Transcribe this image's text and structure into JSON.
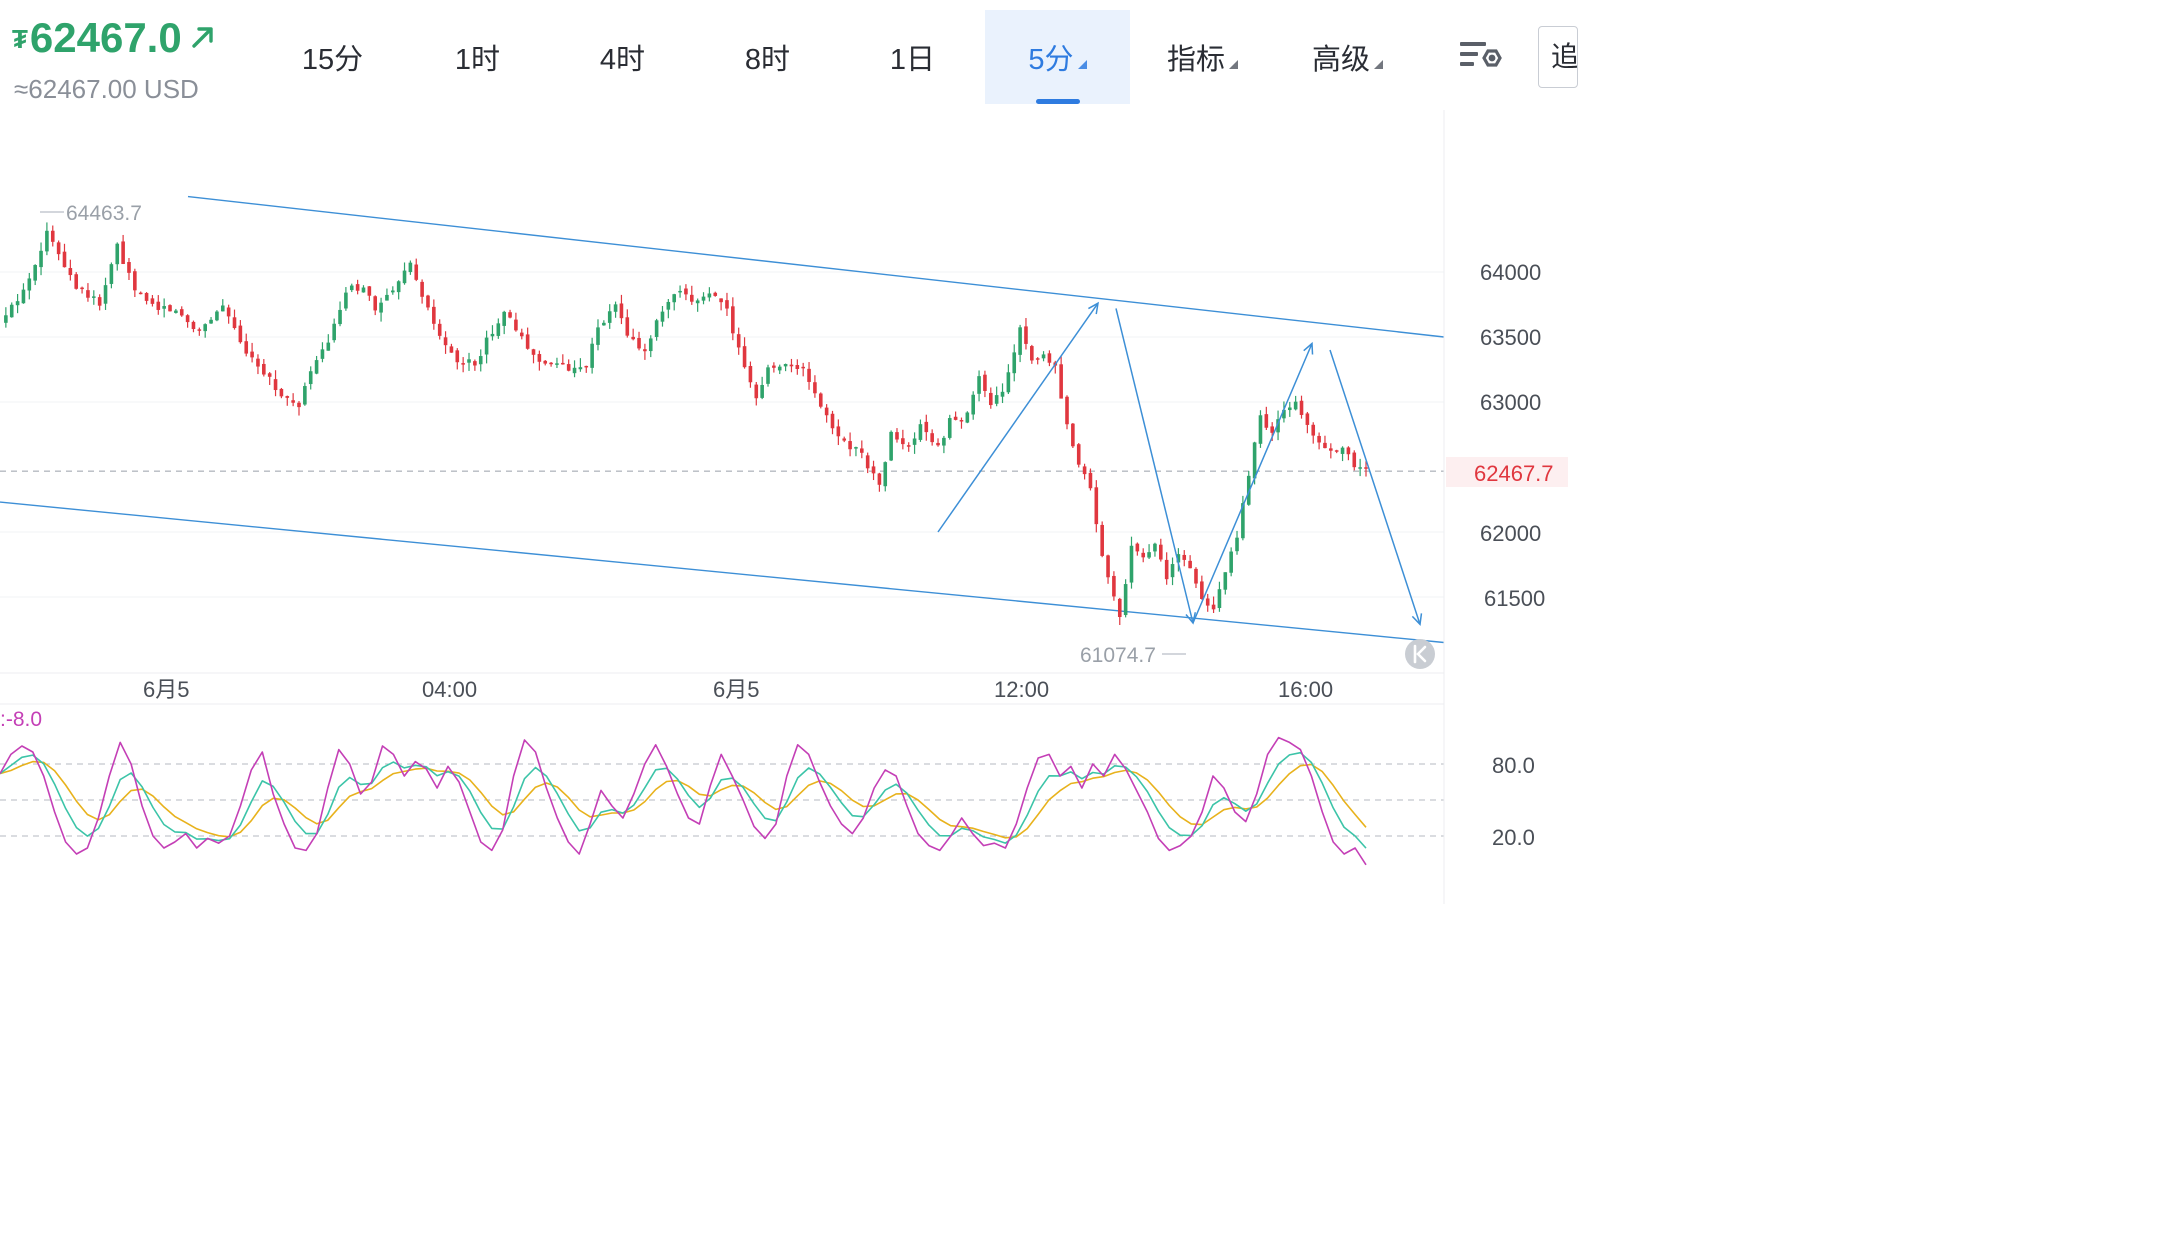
{
  "header": {
    "currency_symbol": "₮",
    "price": "62467.0",
    "usd_equiv": "≈62467.00 USD"
  },
  "tabs": [
    {
      "label": "15分",
      "dropdown": false,
      "active": false
    },
    {
      "label": "1时",
      "dropdown": false,
      "active": false
    },
    {
      "label": "4时",
      "dropdown": false,
      "active": false
    },
    {
      "label": "8时",
      "dropdown": false,
      "active": false
    },
    {
      "label": "1日",
      "dropdown": false,
      "active": false
    },
    {
      "label": "5分",
      "dropdown": true,
      "active": true
    },
    {
      "label": "指标",
      "dropdown": true,
      "active": false
    },
    {
      "label": "高级",
      "dropdown": true,
      "active": false
    }
  ],
  "edge_button_label": "追",
  "icons": {
    "price_arrow": "arrow-up-right-icon",
    "settings": "chart-settings-icon",
    "back": "back-to-latest-icon"
  },
  "colors": {
    "up": "#2fa36b",
    "down": "#e0373f",
    "trend": "#3d8fd6",
    "k_line": "#c43fb6",
    "d_line": "#3cc4a8",
    "j_line": "#e8b21c"
  },
  "chart_data": [
    {
      "type": "candlestick",
      "y_ticks": [
        "64000",
        "63500",
        "63000",
        "62000",
        "61500"
      ],
      "ylim": [
        61000,
        64800
      ],
      "x_ticks": [
        "6月5",
        "04:00",
        "6月5",
        "12:00",
        "16:00"
      ],
      "high_label": "64463.7",
      "low_label": "61074.7",
      "last_price_label": "62467.7",
      "last_price": 62467.7,
      "price_path": [
        [
          0,
          63600
        ],
        [
          4,
          63850
        ],
        [
          8,
          64300
        ],
        [
          10,
          64150
        ],
        [
          13,
          63900
        ],
        [
          17,
          63750
        ],
        [
          20,
          64200
        ],
        [
          23,
          63850
        ],
        [
          26,
          63750
        ],
        [
          30,
          63700
        ],
        [
          34,
          63550
        ],
        [
          38,
          63750
        ],
        [
          41,
          63450
        ],
        [
          44,
          63300
        ],
        [
          48,
          63050
        ],
        [
          51,
          62950
        ],
        [
          53,
          63250
        ],
        [
          56,
          63450
        ],
        [
          59,
          63850
        ],
        [
          62,
          63900
        ],
        [
          64,
          63700
        ],
        [
          67,
          63850
        ],
        [
          70,
          64050
        ],
        [
          72,
          63800
        ],
        [
          75,
          63500
        ],
        [
          78,
          63300
        ],
        [
          81,
          63300
        ],
        [
          84,
          63550
        ],
        [
          86,
          63700
        ],
        [
          88,
          63550
        ],
        [
          91,
          63350
        ],
        [
          94,
          63300
        ],
        [
          97,
          63250
        ],
        [
          100,
          63300
        ],
        [
          102,
          63550
        ],
        [
          105,
          63750
        ],
        [
          107,
          63500
        ],
        [
          110,
          63400
        ],
        [
          113,
          63700
        ],
        [
          116,
          63850
        ],
        [
          118,
          63750
        ],
        [
          121,
          63850
        ],
        [
          124,
          63700
        ],
        [
          126,
          63400
        ],
        [
          129,
          63050
        ],
        [
          131,
          63250
        ],
        [
          134,
          63300
        ],
        [
          137,
          63250
        ],
        [
          139,
          63050
        ],
        [
          142,
          62800
        ],
        [
          144,
          62700
        ],
        [
          147,
          62600
        ],
        [
          150,
          62350
        ],
        [
          152,
          62750
        ],
        [
          155,
          62650
        ],
        [
          157,
          62800
        ],
        [
          160,
          62650
        ],
        [
          162,
          62850
        ],
        [
          165,
          62900
        ],
        [
          167,
          63200
        ],
        [
          169,
          62950
        ],
        [
          171,
          63100
        ],
        [
          174,
          63550
        ],
        [
          176,
          63300
        ],
        [
          178,
          63350
        ],
        [
          180,
          63250
        ],
        [
          182,
          62800
        ],
        [
          184,
          62500
        ],
        [
          186,
          62350
        ],
        [
          188,
          61800
        ],
        [
          191,
          61350
        ],
        [
          193,
          61900
        ],
        [
          195,
          61800
        ],
        [
          197,
          61900
        ],
        [
          199,
          61650
        ],
        [
          201,
          61850
        ],
        [
          203,
          61700
        ],
        [
          205,
          61500
        ],
        [
          207,
          61400
        ],
        [
          209,
          61700
        ],
        [
          211,
          61950
        ],
        [
          213,
          62450
        ],
        [
          215,
          62900
        ],
        [
          217,
          62750
        ],
        [
          219,
          62950
        ],
        [
          221,
          63000
        ],
        [
          223,
          62800
        ],
        [
          225,
          62700
        ],
        [
          227,
          62600
        ],
        [
          229,
          62650
        ],
        [
          231,
          62500
        ],
        [
          233,
          62470
        ]
      ],
      "trend_lines": [
        {
          "name": "channel-top",
          "points": [
            [
              188,
              64580
            ],
            [
              1444,
              63500
            ]
          ]
        },
        {
          "name": "channel-bottom",
          "points": [
            [
              0,
              62230
            ],
            [
              1444,
              61150
            ]
          ]
        }
      ],
      "projection_arrows": [
        {
          "from": [
            938,
            62000
          ],
          "to": [
            1098,
            63760
          ]
        },
        {
          "from": [
            1116,
            63720
          ],
          "to": [
            1193,
            61300
          ]
        },
        {
          "from": [
            1193,
            61300
          ],
          "to": [
            1312,
            63450
          ]
        },
        {
          "from": [
            1330,
            63400
          ],
          "to": [
            1420,
            61290
          ]
        }
      ]
    },
    {
      "type": "line",
      "label": ":-8.0",
      "y_ticks": [
        "80.0",
        "20.0"
      ],
      "ylim": [
        -20,
        120
      ],
      "series": [
        {
          "key": "k",
          "values": [
            72,
            88,
            95,
            90,
            70,
            40,
            15,
            5,
            10,
            35,
            70,
            98,
            80,
            45,
            20,
            10,
            15,
            22,
            10,
            18,
            14,
            20,
            45,
            75,
            90,
            55,
            30,
            10,
            8,
            22,
            60,
            92,
            80,
            55,
            65,
            95,
            88,
            70,
            82,
            76,
            60,
            78,
            65,
            40,
            15,
            8,
            25,
            70,
            100,
            90,
            60,
            35,
            15,
            5,
            30,
            58,
            45,
            35,
            55,
            80,
            96,
            78,
            55,
            35,
            30,
            62,
            88,
            70,
            50,
            28,
            18,
            30,
            70,
            96,
            88,
            65,
            45,
            30,
            22,
            35,
            60,
            75,
            70,
            45,
            22,
            12,
            8,
            20,
            35,
            22,
            12,
            14,
            10,
            30,
            60,
            85,
            88,
            70,
            78,
            60,
            80,
            70,
            88,
            76,
            58,
            40,
            18,
            8,
            12,
            20,
            40,
            70,
            60,
            40,
            32,
            55,
            88,
            102,
            98,
            92,
            70,
            40,
            15,
            5,
            10,
            -4
          ]
        }
      ]
    }
  ]
}
